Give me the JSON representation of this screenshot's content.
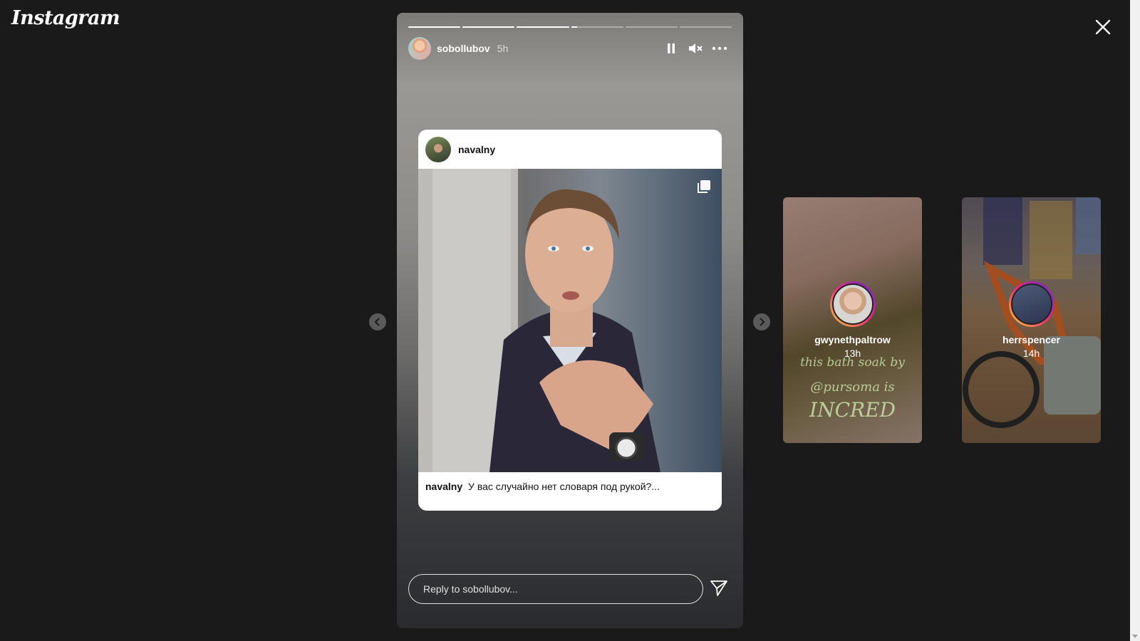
{
  "app": {
    "logo_text": "Instagram"
  },
  "story": {
    "username": "sobollubov",
    "time": "5h",
    "progress_segments": [
      1,
      1,
      1,
      0.12,
      0,
      0
    ],
    "reply_placeholder": "Reply to sobollubov...",
    "shared_post": {
      "username": "navalny",
      "caption_user": "navalny",
      "caption_text": "У вас случайно нет словаря под рукой?..."
    }
  },
  "previews": [
    {
      "username": "gwynethpaltrow",
      "time": "13h",
      "overlay_lines": [
        "this bath soak by",
        "@pursoma is",
        "INCRED"
      ]
    },
    {
      "username": "herrspencer",
      "time": "14h"
    }
  ],
  "icons": {
    "close": "close-icon",
    "pause": "pause-icon",
    "mute": "muted-speaker-icon",
    "more": "more-options-icon",
    "send": "paper-plane-icon",
    "multi": "carousel-icon",
    "prev": "chevron-left-icon",
    "next": "chevron-right-icon"
  },
  "colors": {
    "background": "#1a1a1a",
    "story_ring_start": "#f9ce34",
    "story_ring_mid": "#ee2a7b",
    "story_ring_end": "#6228d7"
  }
}
